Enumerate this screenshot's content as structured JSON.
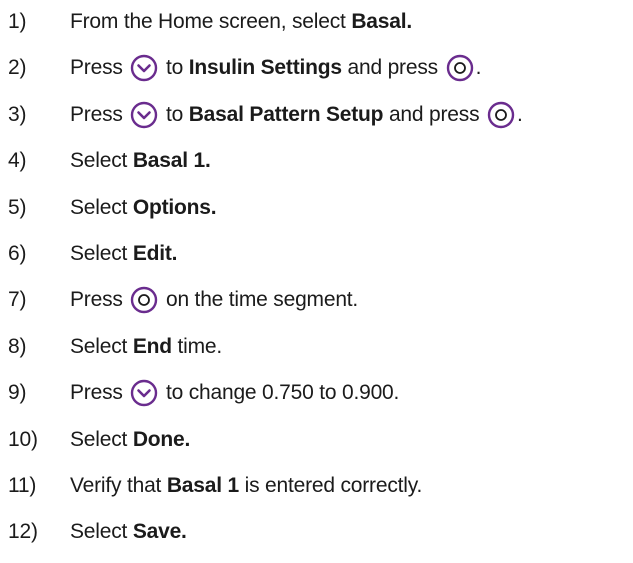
{
  "steps": [
    {
      "num": "1)",
      "parts": [
        {
          "t": "text",
          "v": "From the Home screen, select "
        },
        {
          "t": "bold",
          "v": "Basal."
        }
      ]
    },
    {
      "num": "2)",
      "parts": [
        {
          "t": "text",
          "v": "Press "
        },
        {
          "t": "icon",
          "v": "down-arrow-button-icon"
        },
        {
          "t": "text",
          "v": " to "
        },
        {
          "t": "bold",
          "v": "Insulin Settings"
        },
        {
          "t": "text",
          "v": " and press "
        },
        {
          "t": "icon",
          "v": "select-button-icon"
        },
        {
          "t": "text",
          "v": "."
        }
      ]
    },
    {
      "num": "3)",
      "parts": [
        {
          "t": "text",
          "v": "Press "
        },
        {
          "t": "icon",
          "v": "down-arrow-button-icon"
        },
        {
          "t": "text",
          "v": " to "
        },
        {
          "t": "bold",
          "v": "Basal Pattern Setup"
        },
        {
          "t": "text",
          "v": " and press "
        },
        {
          "t": "icon",
          "v": "select-button-icon"
        },
        {
          "t": "text",
          "v": "."
        }
      ]
    },
    {
      "num": "4)",
      "parts": [
        {
          "t": "text",
          "v": "Select "
        },
        {
          "t": "bold",
          "v": "Basal 1."
        }
      ]
    },
    {
      "num": "5)",
      "parts": [
        {
          "t": "text",
          "v": "Select "
        },
        {
          "t": "bold",
          "v": "Options."
        }
      ]
    },
    {
      "num": "6)",
      "parts": [
        {
          "t": "text",
          "v": "Select "
        },
        {
          "t": "bold",
          "v": "Edit."
        }
      ]
    },
    {
      "num": "7)",
      "parts": [
        {
          "t": "text",
          "v": "Press "
        },
        {
          "t": "icon",
          "v": "select-button-icon"
        },
        {
          "t": "text",
          "v": " on the time segment."
        }
      ]
    },
    {
      "num": "8)",
      "parts": [
        {
          "t": "text",
          "v": "Select "
        },
        {
          "t": "bold",
          "v": "End"
        },
        {
          "t": "text",
          "v": " time."
        }
      ]
    },
    {
      "num": "9)",
      "parts": [
        {
          "t": "text",
          "v": "Press "
        },
        {
          "t": "icon",
          "v": "down-arrow-button-icon"
        },
        {
          "t": "text",
          "v": " to change 0.750 to 0.900."
        }
      ]
    },
    {
      "num": "10)",
      "parts": [
        {
          "t": "text",
          "v": "Select "
        },
        {
          "t": "bold",
          "v": "Done."
        }
      ]
    },
    {
      "num": "11)",
      "parts": [
        {
          "t": "text",
          "v": "Verify that "
        },
        {
          "t": "bold",
          "v": "Basal 1"
        },
        {
          "t": "text",
          "v": " is entered correctly."
        }
      ]
    },
    {
      "num": "12)",
      "parts": [
        {
          "t": "text",
          "v": "Select "
        },
        {
          "t": "bold",
          "v": "Save."
        }
      ]
    }
  ],
  "colors": {
    "text": "#1b1b1b",
    "icon_accent": "#6a2c8e",
    "background": "#ffffff"
  }
}
